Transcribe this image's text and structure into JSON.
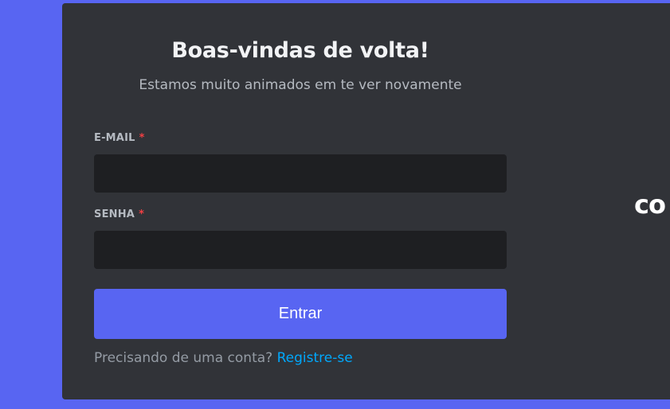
{
  "login": {
    "title": "Boas-vindas de volta!",
    "subtitle": "Estamos muito animados em te ver novamente",
    "email": {
      "label": "E-MAIL",
      "required_mark": "*",
      "value": "",
      "placeholder": ""
    },
    "password": {
      "label": "SENHA",
      "required_mark": "*",
      "value": "",
      "placeholder": ""
    },
    "submit_label": "Entrar",
    "register_prompt": "Precisando de uma conta?",
    "register_link": "Registre-se"
  },
  "side_panel": {
    "partial_text": "co"
  },
  "colors": {
    "background": "#5865f2",
    "panel": "#313338",
    "input": "#1e1f22",
    "button": "#5865f2",
    "link": "#00a8fc",
    "required": "#f23f43"
  }
}
